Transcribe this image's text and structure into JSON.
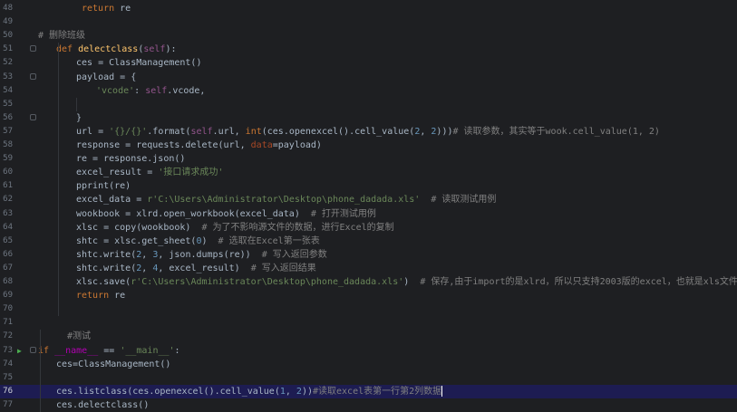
{
  "editor": {
    "lines": [
      {
        "num": "48",
        "indent": 90,
        "tokens": [
          {
            "c": "kw",
            "t": "return"
          },
          {
            "c": "id",
            "t": " re"
          }
        ]
      },
      {
        "num": "49",
        "indent": 0,
        "tokens": []
      },
      {
        "num": "50",
        "indent": 42,
        "tokens": [
          {
            "c": "cm",
            "t": "# 删除班级"
          }
        ]
      },
      {
        "num": "51",
        "indent": 62,
        "tokens": [
          {
            "c": "kw",
            "t": "def "
          },
          {
            "c": "fn",
            "t": "delectclass"
          },
          {
            "c": "op",
            "t": "("
          },
          {
            "c": "self",
            "t": "self"
          },
          {
            "c": "op",
            "t": "):"
          }
        ]
      },
      {
        "num": "52",
        "indent": 84,
        "tokens": [
          {
            "c": "id",
            "t": "ces = ClassManagement()"
          }
        ]
      },
      {
        "num": "53",
        "indent": 84,
        "tokens": [
          {
            "c": "id",
            "t": "payload = {"
          }
        ]
      },
      {
        "num": "54",
        "indent": 106,
        "tokens": [
          {
            "c": "str",
            "t": "'vcode'"
          },
          {
            "c": "id",
            "t": ": "
          },
          {
            "c": "self",
            "t": "self"
          },
          {
            "c": "id",
            "t": ".vcode,"
          }
        ]
      },
      {
        "num": "55",
        "indent": 0,
        "tokens": []
      },
      {
        "num": "56",
        "indent": 84,
        "tokens": [
          {
            "c": "id",
            "t": "}"
          }
        ]
      },
      {
        "num": "57",
        "indent": 84,
        "tokens": [
          {
            "c": "id",
            "t": "url = "
          },
          {
            "c": "str",
            "t": "'{}/{}'"
          },
          {
            "c": "id",
            "t": ".format("
          },
          {
            "c": "self",
            "t": "self"
          },
          {
            "c": "id",
            "t": ".url, "
          },
          {
            "c": "kw",
            "t": "int"
          },
          {
            "c": "id",
            "t": "(ces.openexcel().cell_value("
          },
          {
            "c": "num",
            "t": "2"
          },
          {
            "c": "id",
            "t": ", "
          },
          {
            "c": "num",
            "t": "2"
          },
          {
            "c": "id",
            "t": ")))"
          },
          {
            "c": "cm",
            "t": "# 读取参数，其实等于wook.cell_value(1, 2)"
          }
        ]
      },
      {
        "num": "58",
        "indent": 84,
        "tokens": [
          {
            "c": "id",
            "t": "response = requests.delete(url, "
          },
          {
            "c": "kwarg",
            "t": "data"
          },
          {
            "c": "id",
            "t": "=payload)"
          }
        ]
      },
      {
        "num": "59",
        "indent": 84,
        "tokens": [
          {
            "c": "id",
            "t": "re = response.json()"
          }
        ]
      },
      {
        "num": "60",
        "indent": 84,
        "tokens": [
          {
            "c": "id",
            "t": "excel_result = "
          },
          {
            "c": "str",
            "t": "'接口请求成功'"
          }
        ]
      },
      {
        "num": "61",
        "indent": 84,
        "tokens": [
          {
            "c": "id",
            "t": "pprint(re)"
          }
        ]
      },
      {
        "num": "62",
        "indent": 84,
        "tokens": [
          {
            "c": "id",
            "t": "excel_data = "
          },
          {
            "c": "str",
            "t": "r'C:\\Users\\Administrator\\Desktop\\phone_dadada.xls'"
          },
          {
            "c": "cm",
            "t": "  # 读取测试用例"
          }
        ]
      },
      {
        "num": "63",
        "indent": 84,
        "tokens": [
          {
            "c": "id",
            "t": "wookbook = xlrd.open_workbook(excel_data)"
          },
          {
            "c": "cm",
            "t": "  # 打开测试用例"
          }
        ]
      },
      {
        "num": "64",
        "indent": 84,
        "tokens": [
          {
            "c": "id",
            "t": "xlsc = copy(wookbook)"
          },
          {
            "c": "cm",
            "t": "  # 为了不影响源文件的数据，进行Excel的复制"
          }
        ]
      },
      {
        "num": "65",
        "indent": 84,
        "tokens": [
          {
            "c": "id",
            "t": "shtc = xlsc.get_sheet("
          },
          {
            "c": "num",
            "t": "0"
          },
          {
            "c": "id",
            "t": ")"
          },
          {
            "c": "cm",
            "t": "  # 选取在Excel第一张表"
          }
        ]
      },
      {
        "num": "66",
        "indent": 84,
        "tokens": [
          {
            "c": "id",
            "t": "shtc.write("
          },
          {
            "c": "num",
            "t": "2"
          },
          {
            "c": "id",
            "t": ", "
          },
          {
            "c": "num",
            "t": "3"
          },
          {
            "c": "id",
            "t": ", json.dumps(re))"
          },
          {
            "c": "cm",
            "t": "  # 写入返回参数"
          }
        ]
      },
      {
        "num": "67",
        "indent": 84,
        "tokens": [
          {
            "c": "id",
            "t": "shtc.write("
          },
          {
            "c": "num",
            "t": "2"
          },
          {
            "c": "id",
            "t": ", "
          },
          {
            "c": "num",
            "t": "4"
          },
          {
            "c": "id",
            "t": ", excel_result)"
          },
          {
            "c": "cm",
            "t": "  # 写入返回结果"
          }
        ]
      },
      {
        "num": "68",
        "indent": 84,
        "tokens": [
          {
            "c": "id",
            "t": "xlsc.save("
          },
          {
            "c": "str",
            "t": "r'C:\\Users\\Administrator\\Desktop\\phone_dadada.xls'"
          },
          {
            "c": "id",
            "t": ")"
          },
          {
            "c": "cm",
            "t": "  # 保存,由于import的是xlrd，所以只支持2003版的excel，也就是xls文件，不支持xlsx文件。"
          }
        ]
      },
      {
        "num": "69",
        "indent": 84,
        "tokens": [
          {
            "c": "kw",
            "t": "return"
          },
          {
            "c": "id",
            "t": " re"
          }
        ]
      },
      {
        "num": "70",
        "indent": 0,
        "tokens": []
      },
      {
        "num": "71",
        "indent": 0,
        "tokens": []
      },
      {
        "num": "72",
        "indent": 74,
        "tokens": [
          {
            "c": "cm",
            "t": "#测试"
          }
        ]
      },
      {
        "num": "73",
        "indent": 42,
        "run": "▶",
        "tokens": [
          {
            "c": "kw",
            "t": "if "
          },
          {
            "c": "dunder",
            "t": "__name__"
          },
          {
            "c": "id",
            "t": " == "
          },
          {
            "c": "str",
            "t": "'__main__'"
          },
          {
            "c": "id",
            "t": ":"
          }
        ]
      },
      {
        "num": "74",
        "indent": 62,
        "tokens": [
          {
            "c": "id",
            "t": "ces=ClassManagement()"
          }
        ]
      },
      {
        "num": "75",
        "indent": 0,
        "tokens": []
      },
      {
        "num": "76",
        "indent": 62,
        "current": true,
        "tokens": [
          {
            "c": "id",
            "t": "ces.listclass(ces.openexcel().cell_value("
          },
          {
            "c": "num",
            "t": "1"
          },
          {
            "c": "id",
            "t": ", "
          },
          {
            "c": "num",
            "t": "2"
          },
          {
            "c": "id",
            "t": "))"
          },
          {
            "c": "cm",
            "t": "#读取excel表第一行第2列数据"
          }
        ]
      },
      {
        "num": "77",
        "indent": 62,
        "tokens": [
          {
            "c": "id",
            "t": "ces.delectclass()"
          }
        ]
      }
    ]
  }
}
